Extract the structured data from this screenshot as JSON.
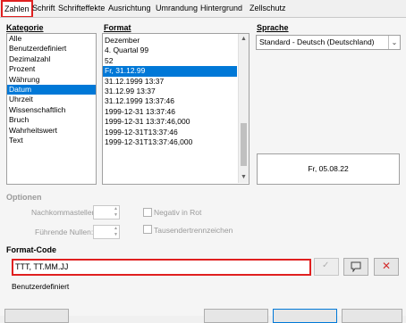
{
  "tabs": [
    "Zahlen",
    "Schrift",
    "Schrifteffekte",
    "Ausrichtung",
    "Umrandung",
    "Hintergrund",
    "Zellschutz"
  ],
  "kategorie": {
    "label": "Kategorie",
    "items": [
      "Alle",
      "Benutzerdefiniert",
      "Dezimalzahl",
      "Prozent",
      "Währung",
      "Datum",
      "Uhrzeit",
      "Wissenschaftlich",
      "Bruch",
      "Wahrheitswert",
      "Text"
    ],
    "selected_index": 5
  },
  "format": {
    "label": "Format",
    "items": [
      "Dezember",
      "4. Quartal 99",
      "52",
      "Fr, 31.12.99",
      "31.12.1999 13:37",
      "31.12.99 13:37",
      "31.12.1999 13:37:46",
      "1999-12-31 13:37:46",
      "1999-12-31 13:37:46,000",
      "1999-12-31T13:37:46",
      "1999-12-31T13:37:46,000"
    ],
    "selected_index": 3
  },
  "sprache": {
    "label": "Sprache",
    "value": "Standard - Deutsch (Deutschland)"
  },
  "preview": "Fr, 05.08.22",
  "optionen": {
    "label": "Optionen",
    "nachkomma_label": "Nachkommastellen:",
    "fuehrende_label": "Führende Nullen:",
    "negativ_label": "Negativ in Rot",
    "tausender_label": "Tausendertrennzeichen"
  },
  "formatcode": {
    "label": "Format-Code",
    "value": "TTT, TT.MM.JJ",
    "description": "Benutzerdefiniert"
  },
  "colors": {
    "accent": "#0078d7",
    "highlight_border": "#e02020",
    "delete_red": "#d32f2f"
  }
}
